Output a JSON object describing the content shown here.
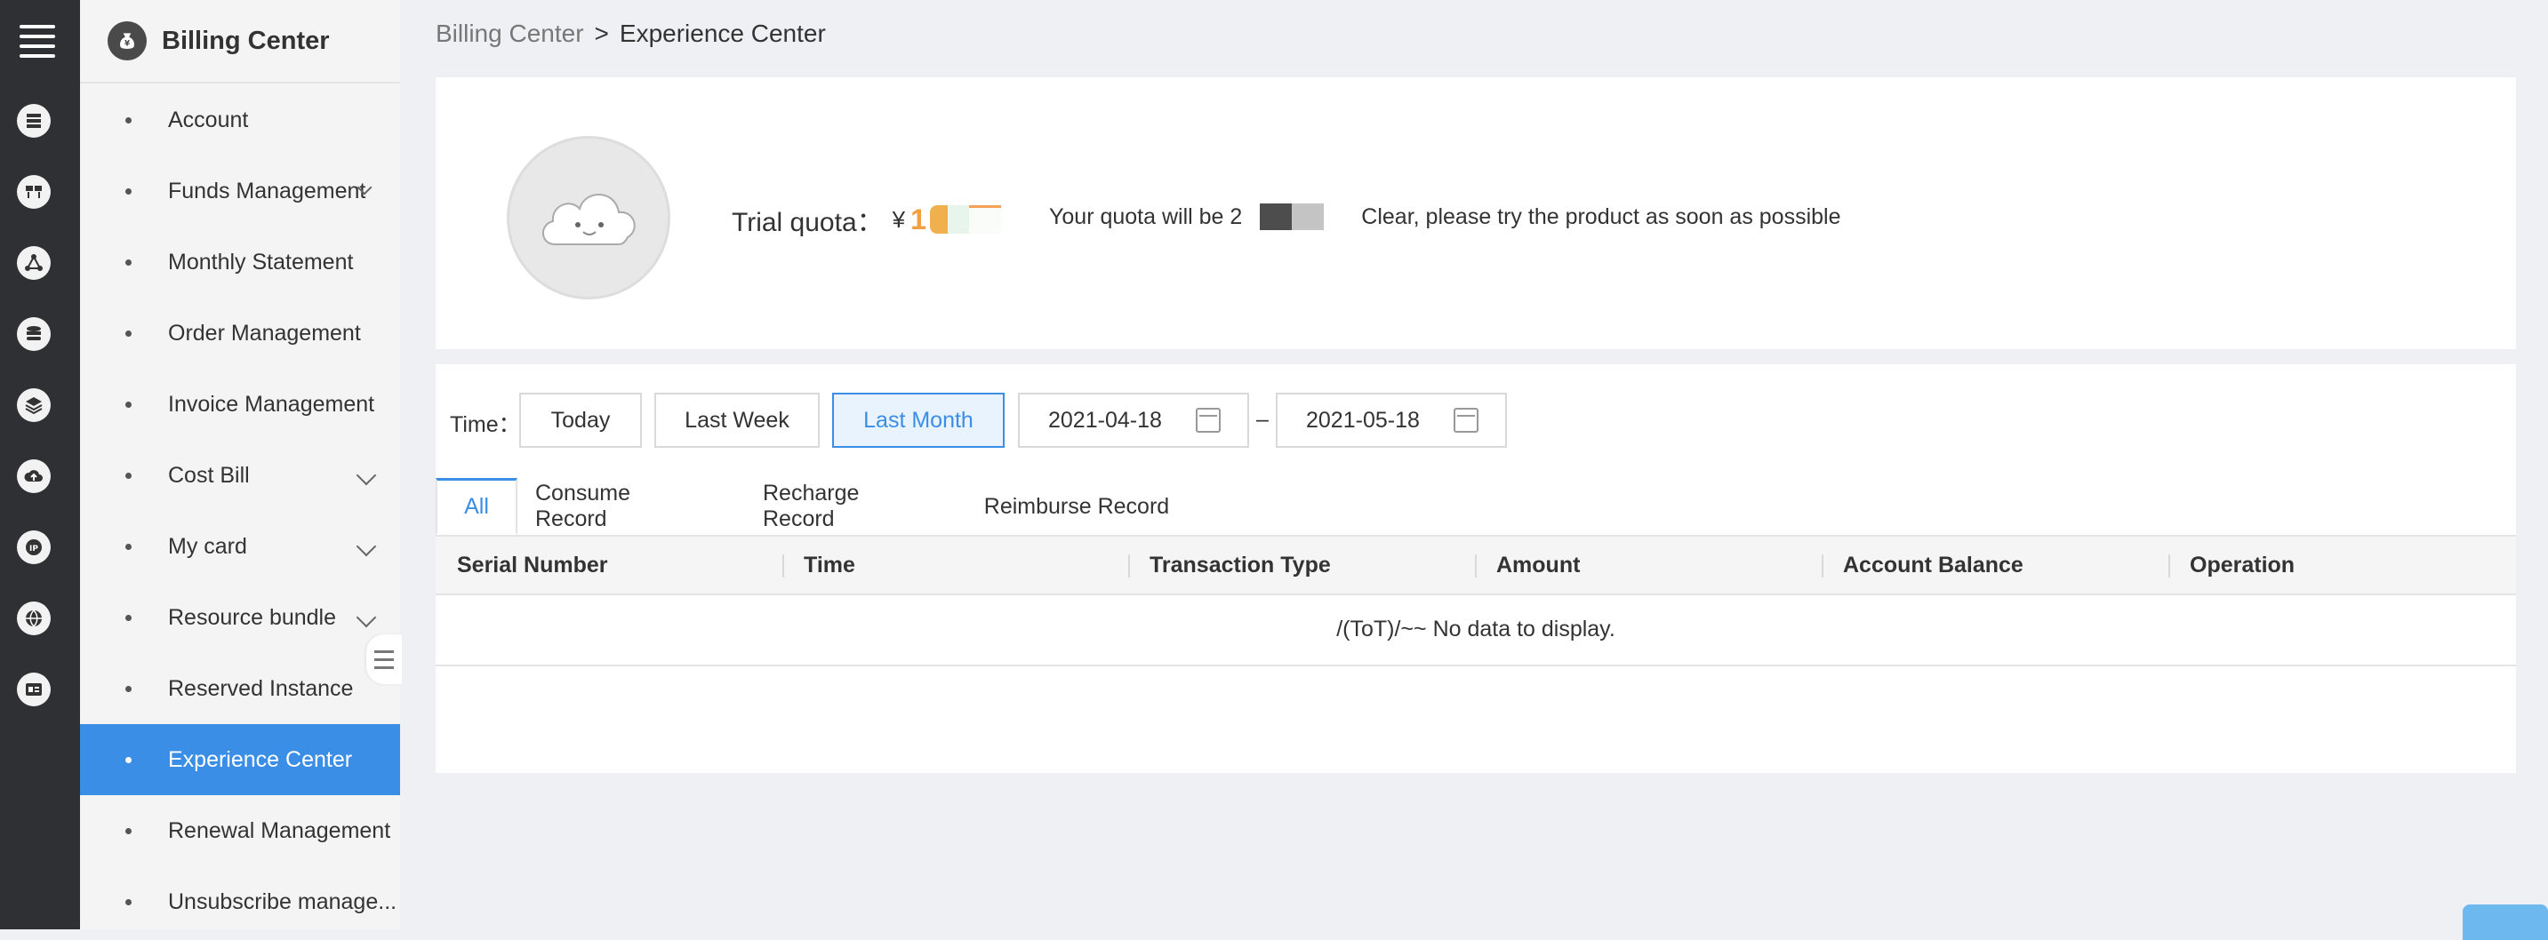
{
  "header": {
    "app_title": "Billing Center"
  },
  "breadcrumb": {
    "parent": "Billing Center",
    "separator": ">",
    "current": "Experience Center"
  },
  "sidebar": {
    "items": [
      {
        "label": "Account",
        "expandable": false,
        "active": false
      },
      {
        "label": "Funds Management",
        "expandable": true,
        "active": false
      },
      {
        "label": "Monthly Statement",
        "expandable": false,
        "active": false
      },
      {
        "label": "Order Management",
        "expandable": false,
        "active": false
      },
      {
        "label": "Invoice Management",
        "expandable": false,
        "active": false
      },
      {
        "label": "Cost Bill",
        "expandable": true,
        "active": false
      },
      {
        "label": "My card",
        "expandable": true,
        "active": false
      },
      {
        "label": "Resource bundle",
        "expandable": true,
        "active": false
      },
      {
        "label": "Reserved Instance",
        "expandable": false,
        "active": false
      },
      {
        "label": "Experience Center",
        "expandable": false,
        "active": true
      },
      {
        "label": "Renewal Management",
        "expandable": false,
        "active": false
      },
      {
        "label": "Unsubscribe manage...",
        "expandable": false,
        "active": false
      }
    ]
  },
  "rail_icons": [
    "server-icon",
    "grid-icon",
    "network-icon",
    "database-icon",
    "layers-icon",
    "cloud-upload-icon",
    "ip-icon",
    "globe-icon",
    "contact-card-icon"
  ],
  "experience": {
    "trial_label": "Trial quota：",
    "currency": "¥",
    "amount_visible": "1",
    "notice_prefix": "Your quota will be 2",
    "notice_suffix": "Clear, please try the product as soon as possible"
  },
  "filter": {
    "time_label": "Time：",
    "buttons": [
      {
        "label": "Today",
        "selected": false
      },
      {
        "label": "Last Week",
        "selected": false
      },
      {
        "label": "Last Month",
        "selected": true
      }
    ],
    "start_date": "2021-04-18",
    "range_sep": "–",
    "end_date": "2021-05-18"
  },
  "tabs": [
    {
      "label": "All",
      "active": true
    },
    {
      "label": "Consume Record",
      "active": false
    },
    {
      "label": "Recharge Record",
      "active": false
    },
    {
      "label": "Reimburse Record",
      "active": false
    }
  ],
  "table": {
    "columns": [
      "Serial Number",
      "Time",
      "Transaction Type",
      "Amount",
      "Account Balance",
      "Operation"
    ],
    "rows": [],
    "empty_text": "/(ToT)/~~ No data to display."
  },
  "colors": {
    "accent": "#3a8ee6",
    "rail_bg": "#2f3033",
    "sidebar_bg": "#f4f4f4",
    "page_bg": "#eef0f3"
  }
}
